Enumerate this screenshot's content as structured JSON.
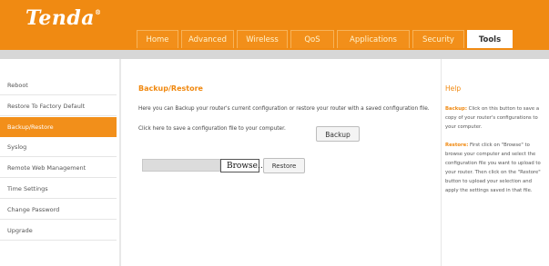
{
  "brand": {
    "logo": "Tenda",
    "mark": "®"
  },
  "nav": {
    "tabs": [
      {
        "label": "Home",
        "width": 46
      },
      {
        "label": "Advanced",
        "width": 58
      },
      {
        "label": "Wireless",
        "width": 56
      },
      {
        "label": "QoS",
        "width": 48
      },
      {
        "label": "Applications",
        "width": 80
      },
      {
        "label": "Security",
        "width": 57
      },
      {
        "label": "Tools",
        "width": 50
      }
    ],
    "active": "Tools"
  },
  "sidebar": {
    "items": [
      {
        "label": "Reboot"
      },
      {
        "label": "Restore To Factory Default"
      },
      {
        "label": "Backup/Restore"
      },
      {
        "label": "Syslog"
      },
      {
        "label": "Remote Web Management"
      },
      {
        "label": "Time Settings"
      },
      {
        "label": "Change Password"
      },
      {
        "label": "Upgrade"
      }
    ],
    "active_index": 2
  },
  "main": {
    "title": "Backup/Restore",
    "description": "Here you can Backup your router's current configuration or restore your router with a saved configuration file.",
    "save_prompt": "Click here to save a configuration file to your computer.",
    "backup_label": "Backup",
    "browse_label": "Browse...",
    "restore_label": "Restore"
  },
  "help": {
    "title": "Help",
    "backup_term": "Backup:",
    "backup_text": "Click on this button to save a copy of your router's configurations to your computer.",
    "restore_term": "Restore:",
    "restore_text": "First click on \"Browse\" to browse your computer and select the configuration file you want to upload to your router. Then click on the \"Restore\" button to upload your selection and apply the settings saved in that file."
  },
  "colors": {
    "accent": "#f08a12",
    "band": "#d7d7d7",
    "link": "#f0880f"
  }
}
